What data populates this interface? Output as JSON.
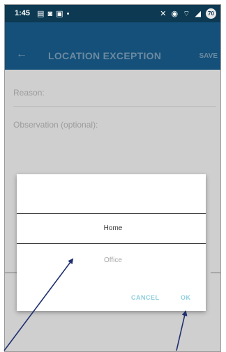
{
  "status_bar": {
    "time": "1:45",
    "battery": "70"
  },
  "toolbar": {
    "title": "LOCATION EXCEPTION",
    "save_label": "SAVE"
  },
  "form": {
    "reason_label": "Reason:",
    "observation_label": "Observation (optional):"
  },
  "dialog": {
    "options": [
      "Home",
      "Office"
    ],
    "selected": "Home",
    "cancel_label": "CANCEL",
    "ok_label": "OK"
  },
  "colors": {
    "status_bar": "#0d3a52",
    "toolbar": "#14507a",
    "dialog_button": "#8ecfdf",
    "annotation_arrow": "#1f2f6e"
  }
}
